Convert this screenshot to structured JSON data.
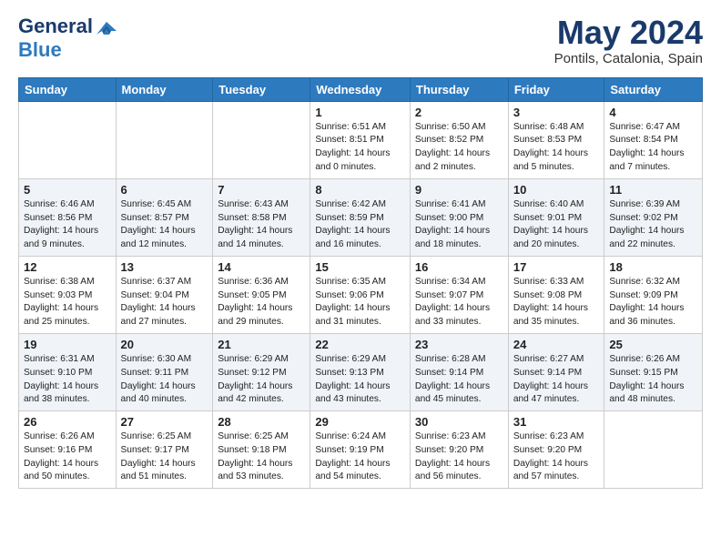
{
  "logo": {
    "line1": "General",
    "line2": "Blue"
  },
  "title": "May 2024",
  "location": "Pontils, Catalonia, Spain",
  "headers": [
    "Sunday",
    "Monday",
    "Tuesday",
    "Wednesday",
    "Thursday",
    "Friday",
    "Saturday"
  ],
  "weeks": [
    [
      {
        "day": "",
        "sunrise": "",
        "sunset": "",
        "daylight": ""
      },
      {
        "day": "",
        "sunrise": "",
        "sunset": "",
        "daylight": ""
      },
      {
        "day": "",
        "sunrise": "",
        "sunset": "",
        "daylight": ""
      },
      {
        "day": "1",
        "sunrise": "Sunrise: 6:51 AM",
        "sunset": "Sunset: 8:51 PM",
        "daylight": "Daylight: 14 hours and 0 minutes."
      },
      {
        "day": "2",
        "sunrise": "Sunrise: 6:50 AM",
        "sunset": "Sunset: 8:52 PM",
        "daylight": "Daylight: 14 hours and 2 minutes."
      },
      {
        "day": "3",
        "sunrise": "Sunrise: 6:48 AM",
        "sunset": "Sunset: 8:53 PM",
        "daylight": "Daylight: 14 hours and 5 minutes."
      },
      {
        "day": "4",
        "sunrise": "Sunrise: 6:47 AM",
        "sunset": "Sunset: 8:54 PM",
        "daylight": "Daylight: 14 hours and 7 minutes."
      }
    ],
    [
      {
        "day": "5",
        "sunrise": "Sunrise: 6:46 AM",
        "sunset": "Sunset: 8:56 PM",
        "daylight": "Daylight: 14 hours and 9 minutes."
      },
      {
        "day": "6",
        "sunrise": "Sunrise: 6:45 AM",
        "sunset": "Sunset: 8:57 PM",
        "daylight": "Daylight: 14 hours and 12 minutes."
      },
      {
        "day": "7",
        "sunrise": "Sunrise: 6:43 AM",
        "sunset": "Sunset: 8:58 PM",
        "daylight": "Daylight: 14 hours and 14 minutes."
      },
      {
        "day": "8",
        "sunrise": "Sunrise: 6:42 AM",
        "sunset": "Sunset: 8:59 PM",
        "daylight": "Daylight: 14 hours and 16 minutes."
      },
      {
        "day": "9",
        "sunrise": "Sunrise: 6:41 AM",
        "sunset": "Sunset: 9:00 PM",
        "daylight": "Daylight: 14 hours and 18 minutes."
      },
      {
        "day": "10",
        "sunrise": "Sunrise: 6:40 AM",
        "sunset": "Sunset: 9:01 PM",
        "daylight": "Daylight: 14 hours and 20 minutes."
      },
      {
        "day": "11",
        "sunrise": "Sunrise: 6:39 AM",
        "sunset": "Sunset: 9:02 PM",
        "daylight": "Daylight: 14 hours and 22 minutes."
      }
    ],
    [
      {
        "day": "12",
        "sunrise": "Sunrise: 6:38 AM",
        "sunset": "Sunset: 9:03 PM",
        "daylight": "Daylight: 14 hours and 25 minutes."
      },
      {
        "day": "13",
        "sunrise": "Sunrise: 6:37 AM",
        "sunset": "Sunset: 9:04 PM",
        "daylight": "Daylight: 14 hours and 27 minutes."
      },
      {
        "day": "14",
        "sunrise": "Sunrise: 6:36 AM",
        "sunset": "Sunset: 9:05 PM",
        "daylight": "Daylight: 14 hours and 29 minutes."
      },
      {
        "day": "15",
        "sunrise": "Sunrise: 6:35 AM",
        "sunset": "Sunset: 9:06 PM",
        "daylight": "Daylight: 14 hours and 31 minutes."
      },
      {
        "day": "16",
        "sunrise": "Sunrise: 6:34 AM",
        "sunset": "Sunset: 9:07 PM",
        "daylight": "Daylight: 14 hours and 33 minutes."
      },
      {
        "day": "17",
        "sunrise": "Sunrise: 6:33 AM",
        "sunset": "Sunset: 9:08 PM",
        "daylight": "Daylight: 14 hours and 35 minutes."
      },
      {
        "day": "18",
        "sunrise": "Sunrise: 6:32 AM",
        "sunset": "Sunset: 9:09 PM",
        "daylight": "Daylight: 14 hours and 36 minutes."
      }
    ],
    [
      {
        "day": "19",
        "sunrise": "Sunrise: 6:31 AM",
        "sunset": "Sunset: 9:10 PM",
        "daylight": "Daylight: 14 hours and 38 minutes."
      },
      {
        "day": "20",
        "sunrise": "Sunrise: 6:30 AM",
        "sunset": "Sunset: 9:11 PM",
        "daylight": "Daylight: 14 hours and 40 minutes."
      },
      {
        "day": "21",
        "sunrise": "Sunrise: 6:29 AM",
        "sunset": "Sunset: 9:12 PM",
        "daylight": "Daylight: 14 hours and 42 minutes."
      },
      {
        "day": "22",
        "sunrise": "Sunrise: 6:29 AM",
        "sunset": "Sunset: 9:13 PM",
        "daylight": "Daylight: 14 hours and 43 minutes."
      },
      {
        "day": "23",
        "sunrise": "Sunrise: 6:28 AM",
        "sunset": "Sunset: 9:14 PM",
        "daylight": "Daylight: 14 hours and 45 minutes."
      },
      {
        "day": "24",
        "sunrise": "Sunrise: 6:27 AM",
        "sunset": "Sunset: 9:14 PM",
        "daylight": "Daylight: 14 hours and 47 minutes."
      },
      {
        "day": "25",
        "sunrise": "Sunrise: 6:26 AM",
        "sunset": "Sunset: 9:15 PM",
        "daylight": "Daylight: 14 hours and 48 minutes."
      }
    ],
    [
      {
        "day": "26",
        "sunrise": "Sunrise: 6:26 AM",
        "sunset": "Sunset: 9:16 PM",
        "daylight": "Daylight: 14 hours and 50 minutes."
      },
      {
        "day": "27",
        "sunrise": "Sunrise: 6:25 AM",
        "sunset": "Sunset: 9:17 PM",
        "daylight": "Daylight: 14 hours and 51 minutes."
      },
      {
        "day": "28",
        "sunrise": "Sunrise: 6:25 AM",
        "sunset": "Sunset: 9:18 PM",
        "daylight": "Daylight: 14 hours and 53 minutes."
      },
      {
        "day": "29",
        "sunrise": "Sunrise: 6:24 AM",
        "sunset": "Sunset: 9:19 PM",
        "daylight": "Daylight: 14 hours and 54 minutes."
      },
      {
        "day": "30",
        "sunrise": "Sunrise: 6:23 AM",
        "sunset": "Sunset: 9:20 PM",
        "daylight": "Daylight: 14 hours and 56 minutes."
      },
      {
        "day": "31",
        "sunrise": "Sunrise: 6:23 AM",
        "sunset": "Sunset: 9:20 PM",
        "daylight": "Daylight: 14 hours and 57 minutes."
      },
      {
        "day": "",
        "sunrise": "",
        "sunset": "",
        "daylight": ""
      }
    ]
  ]
}
